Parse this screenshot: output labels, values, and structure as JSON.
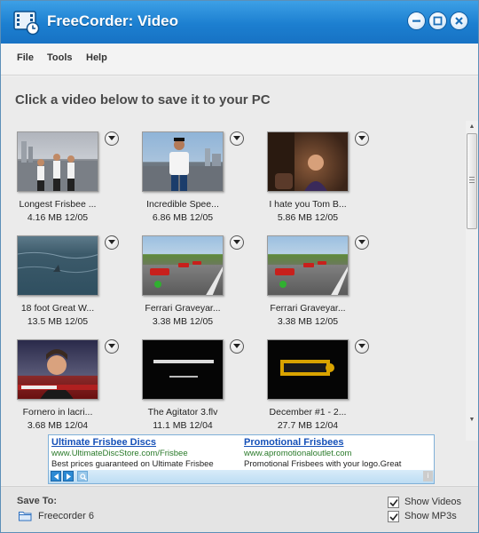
{
  "window": {
    "title": "FreeCorder: Video",
    "accent_color": "#1c7fd0",
    "title_icon": "film-clock-icon",
    "controls": [
      "minimize-icon",
      "maximize-icon",
      "close-icon"
    ]
  },
  "menu": {
    "items": [
      "File",
      "Tools",
      "Help"
    ]
  },
  "main": {
    "heading": "Click a video below to save it to your PC",
    "videos": [
      {
        "title": "Longest Frisbee ...",
        "meta": "4.16 MB 12/05"
      },
      {
        "title": "Incredible Spee...",
        "meta": "6.86 MB 12/05"
      },
      {
        "title": "I hate you Tom B...",
        "meta": "5.86 MB 12/05"
      },
      {
        "title": "18 foot Great W...",
        "meta": "13.5 MB 12/05"
      },
      {
        "title": "Ferrari Graveyar...",
        "meta": "3.38 MB 12/05"
      },
      {
        "title": "Ferrari Graveyar...",
        "meta": "3.38 MB 12/05"
      },
      {
        "title": "Fornero in lacri...",
        "meta": "3.68 MB 12/04"
      },
      {
        "title": "The Agitator 3.flv",
        "meta": "11.1 MB 12/04"
      },
      {
        "title": "December #1 - 2...",
        "meta": "27.7 MB 12/04"
      }
    ]
  },
  "ad": {
    "left": {
      "title": "Ultimate Frisbee Discs",
      "url": "www.UltimateDiscStore.com/Frisbee",
      "desc": "Best prices guaranteed on Ultimate Frisbee"
    },
    "right": {
      "title": "Promotional Frisbees",
      "url": "www.apromotionaloutlet.com",
      "desc": "Promotional Frisbees with your logo.Great"
    }
  },
  "footer": {
    "save_to_label": "Save To:",
    "folder": "Freecorder 6",
    "show_videos_label": "Show Videos",
    "show_videos_checked": true,
    "show_mp3s_label": "Show MP3s",
    "show_mp3s_checked": true
  }
}
